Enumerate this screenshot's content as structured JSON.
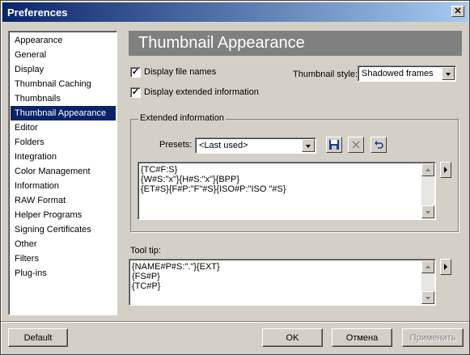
{
  "window": {
    "title": "Preferences",
    "close": "✕"
  },
  "sidebar": {
    "items": [
      {
        "label": "Appearance"
      },
      {
        "label": "General"
      },
      {
        "label": "Display"
      },
      {
        "label": "Thumbnail Caching"
      },
      {
        "label": "Thumbnails"
      },
      {
        "label": "Thumbnail Appearance"
      },
      {
        "label": "Editor"
      },
      {
        "label": "Folders"
      },
      {
        "label": "Integration"
      },
      {
        "label": "Color Management"
      },
      {
        "label": "Information"
      },
      {
        "label": "RAW Format"
      },
      {
        "label": "Helper Programs"
      },
      {
        "label": "Signing Certificates"
      },
      {
        "label": "Other"
      },
      {
        "label": "Filters"
      },
      {
        "label": "Plug-ins"
      }
    ],
    "selected": "Thumbnail Appearance"
  },
  "panel": {
    "title": "Thumbnail Appearance",
    "display_file_names": {
      "label": "Display file names",
      "checked": true,
      "mark": "✓"
    },
    "display_extended": {
      "label": "Display extended information",
      "checked": true,
      "mark": "✓"
    },
    "thumbnail_style": {
      "label": "Thumbnail style:",
      "value": "Shadowed frames"
    },
    "extended": {
      "legend": "Extended information",
      "presets_label": "Presets:",
      "presets_value": "<Last used>",
      "save_icon": "floppy-disk-icon",
      "delete_icon": "x-icon",
      "undo_icon": "undo-icon",
      "text_lines": [
        "{TC#F:S}",
        "{W#S:\"x\"}{H#S:\"x\"}{BPP}",
        "{ET#S}{F#P:\"F\"#S}{ISO#P:\"ISO \"#S}"
      ]
    },
    "tooltip": {
      "label": "Tool tip:",
      "text_lines": [
        "{NAME#P#S:\".\"}{EXT}",
        "{FS#P}",
        "{TC#P}"
      ]
    }
  },
  "footer": {
    "default_label": "Default",
    "ok_label": "OK",
    "cancel_label": "Отмена",
    "apply_label": "Применить"
  }
}
